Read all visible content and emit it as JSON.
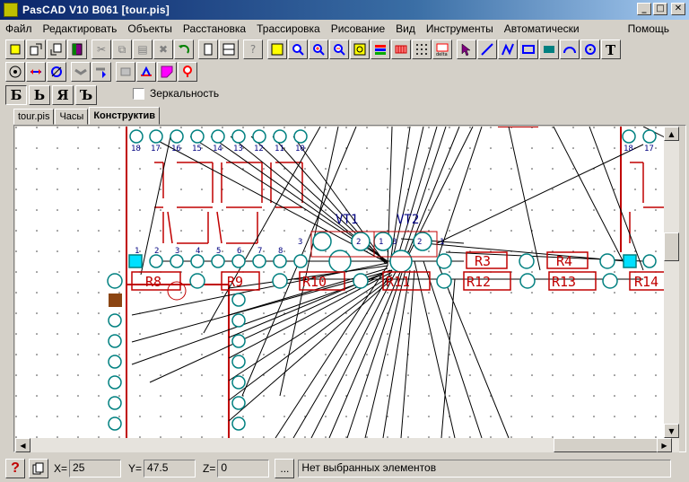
{
  "window": {
    "title": "PasCAD V10 B061 [tour.pis]",
    "minimize": "_",
    "maximize": "□",
    "close": "✕"
  },
  "menu": {
    "items": [
      "Файл",
      "Редактировать",
      "Объекты",
      "Расстановка",
      "Трассировка",
      "Рисование",
      "Вид",
      "Инструменты",
      "Автоматически"
    ],
    "help": "Помощь"
  },
  "layers": {
    "buttons": [
      "Б",
      "Ь",
      "Я",
      "Ъ"
    ],
    "mirror_label": "Зеркальность"
  },
  "tabs": [
    "tour.pis",
    "Часы",
    "Конструктив"
  ],
  "canvas": {
    "labels": {
      "vt1": "VT1",
      "vt2": "VT2",
      "resistors": [
        "R8",
        "R9",
        "R10",
        "R11",
        "R12",
        "R13",
        "R14"
      ],
      "r3": "R3",
      "r4": "R4",
      "top_pins": [
        "18",
        "17",
        "16",
        "15",
        "14",
        "13",
        "12",
        "11",
        "10"
      ],
      "row_pins": [
        "1",
        "2",
        "3",
        "4",
        "5",
        "6",
        "7",
        "8"
      ],
      "right_pins_top": [
        "18",
        "17"
      ],
      "vt_pins": [
        "3",
        "2",
        "1",
        "3",
        "2",
        "1"
      ]
    }
  },
  "status": {
    "x_label": "X=",
    "x_value": "25",
    "y_label": "Y=",
    "y_value": "47.5",
    "z_label": "Z=",
    "z_value": "0",
    "dots": "...",
    "message": "Нет выбранных элементов"
  },
  "colors": {
    "track": "#000000",
    "pad": "#008080",
    "outline": "#c00000",
    "label": "#000080",
    "accent": "#0a246a"
  },
  "icons": {
    "toolbar1": [
      "snap-icon",
      "export-icon",
      "import-icon",
      "book-icon",
      "cut-icon",
      "copy-icon",
      "paste-icon",
      "delete-icon",
      "undo-icon",
      "page-icon",
      "layout-icon",
      "help-query-icon",
      "zoom-fit-icon",
      "zoom-icon",
      "zoom-in-icon",
      "zoom-out-icon",
      "zoom-window-icon",
      "layers-icon",
      "pins-icon",
      "grid-icon",
      "delta-icon",
      "select-arrow-icon",
      "line-icon",
      "polyline-icon",
      "rectangle-icon",
      "fill-icon",
      "arc-icon",
      "circle-icon",
      "text-icon"
    ],
    "toolbar2": [
      "component-icon",
      "measure-icon",
      "rotate-icon",
      "route-icon",
      "route-down-icon",
      "align-icon",
      "align-up-icon",
      "shape-icon",
      "pad-icon"
    ]
  }
}
